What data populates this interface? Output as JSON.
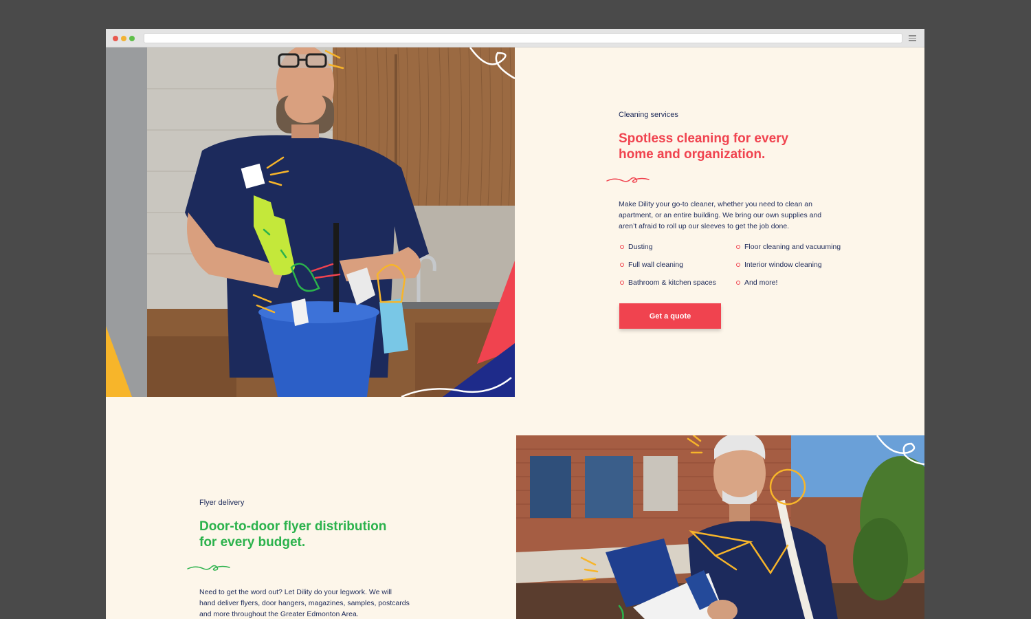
{
  "colors": {
    "frame_bg": "#4a4a4a",
    "page_bg": "#fdf6ea",
    "accent_red": "#f0434f",
    "accent_green": "#2bb24c",
    "navy": "#1e2b5a",
    "accent_yellow": "#f7b52a"
  },
  "browser": {
    "icons": [
      "close-dot",
      "minimize-dot",
      "maximize-dot",
      "hamburger-menu-icon"
    ]
  },
  "cleaning": {
    "label": "Cleaning services",
    "headline_line1": "Spotless cleaning for every",
    "headline_line2": "home and organization.",
    "body_line1": "Make Dility your go-to cleaner, whether you need to clean an",
    "body_line2": "apartment, or an entire building. We bring our own supplies and",
    "body_line3": "aren’t afraid to roll up our sleeves to get the job done.",
    "features": [
      "Dusting",
      "Floor cleaning and vacuuming",
      "Full wall cleaning",
      "Interior window cleaning",
      "Bathroom & kitchen spaces",
      "And more!"
    ],
    "cta_label": "Get a quote"
  },
  "flyer": {
    "label": "Flyer delivery",
    "headline_line1": "Door-to-door flyer distribution",
    "headline_line2": "for every budget.",
    "body_line1": "Need to get the word out? Let Dility do your legwork. We will",
    "body_line2": "hand deliver flyers, door hangers, magazines, samples, postcards",
    "body_line3": "and more throughout the Greater Edmonton Area."
  }
}
